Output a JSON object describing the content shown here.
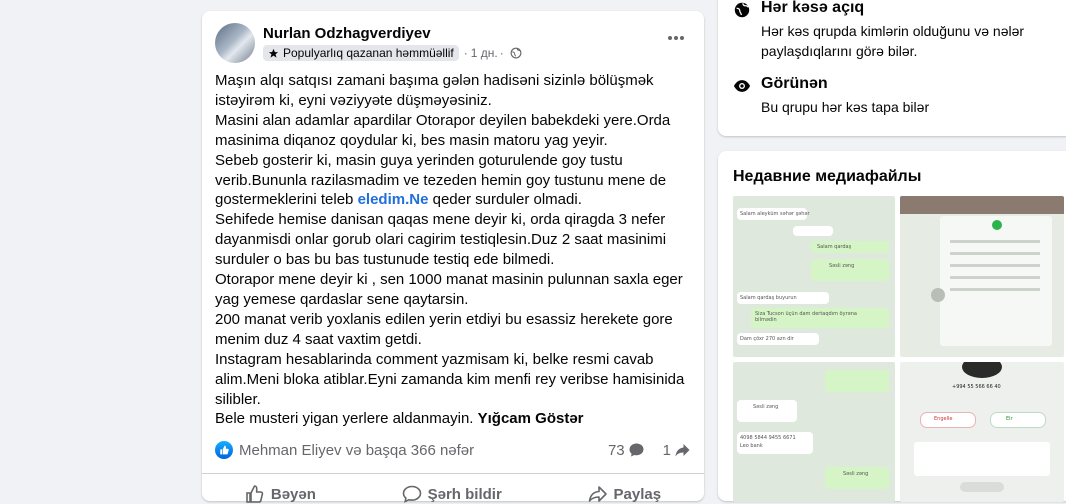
{
  "post": {
    "author": "Nurlan Odzhagverdiyev",
    "badge": "Populyarlıq qazanan həmmüəllif",
    "time": "1 дн.",
    "text_lines": [
      "Maşın alqı satqısı zamani başıma gələn hadisəni sizinlə bölüşmək",
      "istəyirəm ki, eyni vəziyyəte düşməyəsiniz.",
      "Masini alan adamlar apardilar Otorapor deyilen babekdeki yere.Orda",
      "masinima diqanoz qoydular ki, bes masin matoru yag yeyir.",
      "Sebeb gosterir ki, masin guya yerinden goturulende goy tustu",
      "verib.Bununla razilasmadim ve tezeden hemin goy tustunu mene de",
      "gostermeklerini teleb ",
      "Sehifede hemise danisan qaqas mene deyir ki, orda qiragda 3 nefer",
      "dayanmisdi onlar gorub olari cagirim testiqlesin.Duz 2 saat masinimi",
      "surduler o bas bu bas tustunude testiq ede bilmedi.",
      "Otorapor mene deyir ki , sen 1000 manat masinin pulunnan saxla eger",
      "yag yemese qardaslar sene qaytarsin.",
      "200 manat verib yoxlanis edilen yerin etdiyi bu esassiz herekete gore",
      "menim duz 4 saat vaxtim getdi.",
      "Instagram hesablarinda comment yazmisam ki, belke resmi cavab",
      "alim.Meni bloka atiblar.Eyni zamanda kim menfi rey veribse hamisinida",
      "silibler.",
      "Bele musteri yigan yerlere aldanmayin. "
    ],
    "hashtag": "eledim.Ne",
    "after_hashtag": " qeder surduler olmadi.",
    "see_less": "Yığcam Göstər",
    "reactions_text": "Mehman Eliyev və başqa 366 nəfər",
    "comments_count": "73",
    "shares_count": "1",
    "actions": {
      "like": "Bəyən",
      "comment": "Şərh bildir",
      "share": "Paylaş"
    }
  },
  "about": {
    "items": [
      {
        "title": "Hər kəsə açıq",
        "desc": "Hər kəs qrupda kimlərin olduğunu və nələr paylaşdıqlarını görə bilər."
      },
      {
        "title": "Görünən",
        "desc": "Bu qrupu hər kəs tapa bilər"
      }
    ]
  },
  "media": {
    "title": "Недавние медиафайлы",
    "thumbs": [
      {
        "lines": [
          "Salam aleyküm səhər şəhər",
          "Salam qardaş",
          "Səsli zəng",
          "Salam qardaş buyurun",
          "Siza Tucson üçün dam dertaqdım öyrəna bilmədin",
          "Dam çöxr 270 azn dir"
        ]
      },
      {
        "lines": []
      },
      {
        "lines": [
          "Səsli zəng",
          "4098 5844 9455 6671",
          "Leo bank",
          "Səsli zəng"
        ]
      },
      {
        "lines": [
          "+994 55 566 66 40",
          "Engelle",
          "Elr"
        ]
      }
    ]
  },
  "colors": {
    "accent": "#216fdb",
    "text": "#050505",
    "secondary": "#65676b",
    "bg": "#f0f2f5"
  }
}
